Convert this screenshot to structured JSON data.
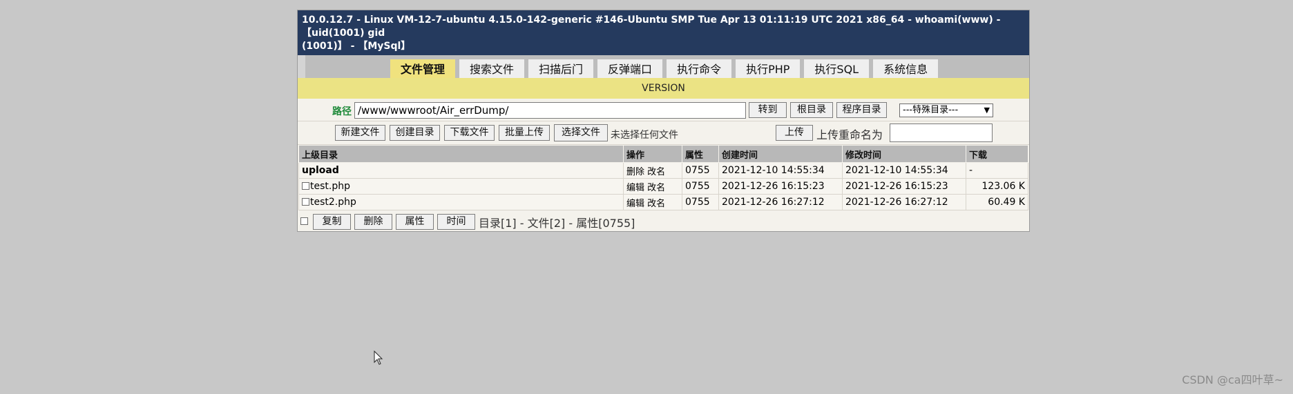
{
  "header": {
    "line1": "10.0.12.7 - Linux VM-12-7-ubuntu 4.15.0-142-generic #146-Ubuntu SMP Tue Apr 13 01:11:19 UTC 2021 x86_64 - whoami(www) - 【uid(1001) gid",
    "line2": "(1001)】 - 【MySql】"
  },
  "tabs": [
    {
      "label": "文件管理",
      "active": true
    },
    {
      "label": "搜索文件"
    },
    {
      "label": "扫描后门"
    },
    {
      "label": "反弹端口"
    },
    {
      "label": "执行命令"
    },
    {
      "label": "执行PHP"
    },
    {
      "label": "执行SQL"
    },
    {
      "label": "系统信息"
    }
  ],
  "version_label": "VERSION",
  "path": {
    "label": "路径",
    "value": "/www/wwwroot/Air_errDump/",
    "goto_btn": "转到",
    "root_btn": "根目录",
    "program_btn": "程序目录",
    "special_select": "---特殊目录---"
  },
  "toolbar": {
    "new_file": "新建文件",
    "create_dir": "创建目录",
    "download": "下载文件",
    "batch_upload": "批量上传",
    "choose_file": "选择文件",
    "no_file_text": "未选择任何文件",
    "upload": "上传",
    "rename_label": "上传重命名为"
  },
  "table": {
    "headers": [
      "上级目录",
      "操作",
      "属性",
      "创建时间",
      "修改时间",
      "下载"
    ],
    "rows": [
      {
        "name": "upload",
        "ops": "删除 改名",
        "attr": "0755",
        "created": "2021-12-10 14:55:34",
        "modified": "2021-12-10 14:55:34",
        "size": "-"
      },
      {
        "name": "test.php",
        "ops": "编辑 改名",
        "attr": "0755",
        "created": "2021-12-26 16:15:23",
        "modified": "2021-12-26 16:15:23",
        "size": "123.06 K"
      },
      {
        "name": "test2.php",
        "ops": "编辑 改名",
        "attr": "0755",
        "created": "2021-12-26 16:27:12",
        "modified": "2021-12-26 16:27:12",
        "size": "60.49 K"
      }
    ]
  },
  "bottom": {
    "copy": "复制",
    "delete": "删除",
    "attr": "属性",
    "time": "时间",
    "summary": "目录[1] - 文件[2] - 属性[0755]"
  },
  "watermark": "CSDN @ca四叶草~"
}
